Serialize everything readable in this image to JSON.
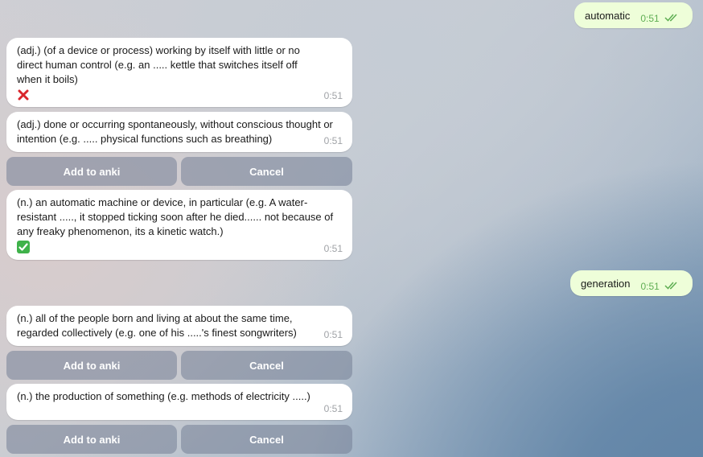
{
  "messages": {
    "out1": {
      "text": "automatic",
      "time": "0:51"
    },
    "def1": {
      "text": "(adj.) (of a device or process) working by itself with little or no direct human control (e.g. an ..... kettle that switches itself off when it boils)",
      "time": "0:51",
      "status_icon": "cross-mark-icon"
    },
    "def2": {
      "text": "(adj.) done or occurring spontaneously, without conscious thought or intention (e.g. ..... physical functions such as breathing)",
      "time": "0:51"
    },
    "def3": {
      "text": "(n.) an automatic machine or device, in particular (e.g. A water-resistant ....., it stopped ticking soon after he died...... not because of any freaky phenomenon, its a kinetic watch.)",
      "time": "0:51",
      "status_icon": "check-mark-icon"
    },
    "out2": {
      "text": "generation",
      "time": "0:51"
    },
    "def4": {
      "text": "(n.) all of the people born and living at about the same time, regarded collectively (e.g. one of his .....'s finest songwriters)",
      "time": "0:51"
    },
    "def5": {
      "text": "(n.) the production of something (e.g. methods of electricity .....)",
      "time": "0:51"
    }
  },
  "buttons": {
    "add": "Add to anki",
    "cancel": "Cancel"
  },
  "colors": {
    "outgoing_bubble": "#eefed9",
    "outgoing_time": "#5fae53",
    "incoming_bubble": "#ffffff",
    "button_bg": "#8e98aa",
    "cross": "#d9262c",
    "check": "#3fb24a"
  }
}
